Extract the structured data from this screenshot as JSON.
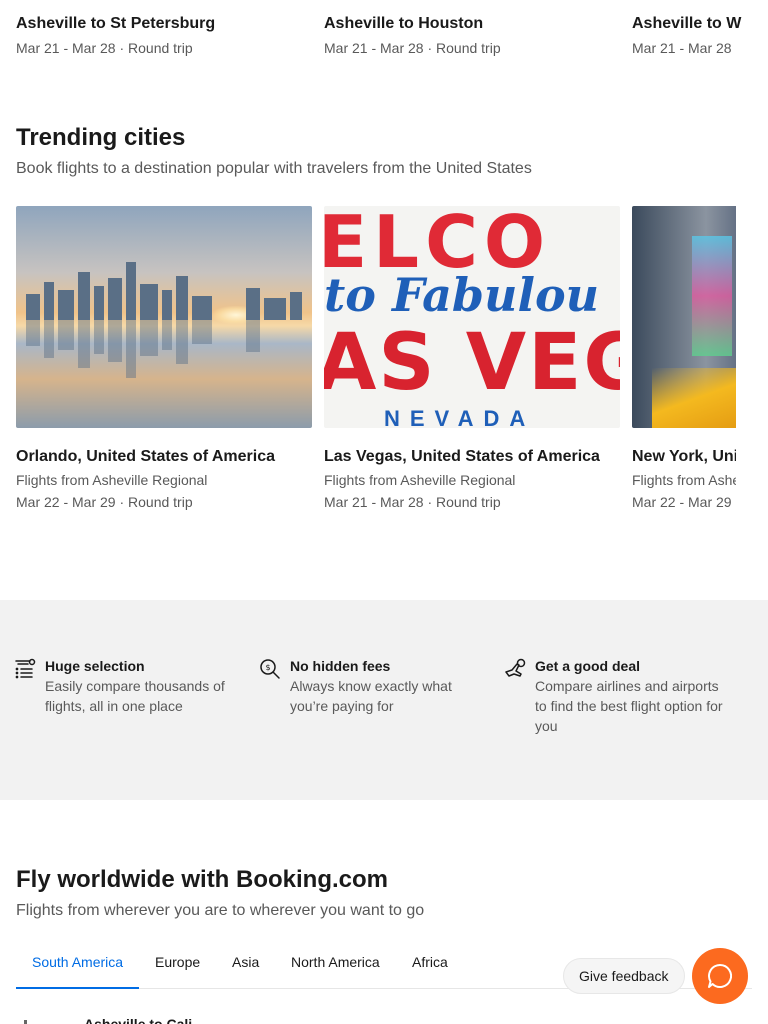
{
  "top_routes": [
    {
      "title": "Asheville to St Petersburg",
      "meta": "Mar 21 - Mar 28 · Round trip"
    },
    {
      "title": "Asheville to Houston",
      "meta": "Mar 21 - Mar 28 · Round trip"
    },
    {
      "title": "Asheville to W",
      "meta": "Mar 21 - Mar 28"
    }
  ],
  "trending": {
    "title": "Trending cities",
    "subtitle": "Book flights to a destination popular with travelers from the United States",
    "cities": [
      {
        "title": "Orlando, United States of America",
        "from": "Flights from Asheville Regional",
        "dates": "Mar 22 - Mar 29 · Round trip"
      },
      {
        "title": "Las Vegas, United States of America",
        "from": "Flights from Asheville Regional",
        "dates": "Mar 21 - Mar 28 · Round trip",
        "sign": {
          "top": "ELCO",
          "mid": "to Fabulou",
          "big": "AS VEG",
          "bot": "NEVADA"
        }
      },
      {
        "title": "New York, Uni",
        "from": "Flights from Ashe",
        "dates": "Mar 22 - Mar 29"
      }
    ]
  },
  "benefits": [
    {
      "icon": "list-icon",
      "title": "Huge selection",
      "desc": "Easily compare thousands of flights, all in one place"
    },
    {
      "icon": "magnifier-dollar-icon",
      "title": "No hidden fees",
      "desc": "Always know exactly what you’re paying for"
    },
    {
      "icon": "plane-deal-icon",
      "title": "Get a good deal",
      "desc": "Compare airlines and airports to find the best flight option for you"
    }
  ],
  "worldwide": {
    "title": "Fly worldwide with Booking.com",
    "subtitle": "Flights from wherever you are to wherever you want to go",
    "tabs": [
      "South America",
      "Europe",
      "Asia",
      "North America",
      "Africa"
    ],
    "active_tab": "South America",
    "first_route": "Asheville to Cali"
  },
  "feedback_label": "Give feedback",
  "colors": {
    "accent": "#006ce4",
    "chat": "#fc6a1f"
  }
}
